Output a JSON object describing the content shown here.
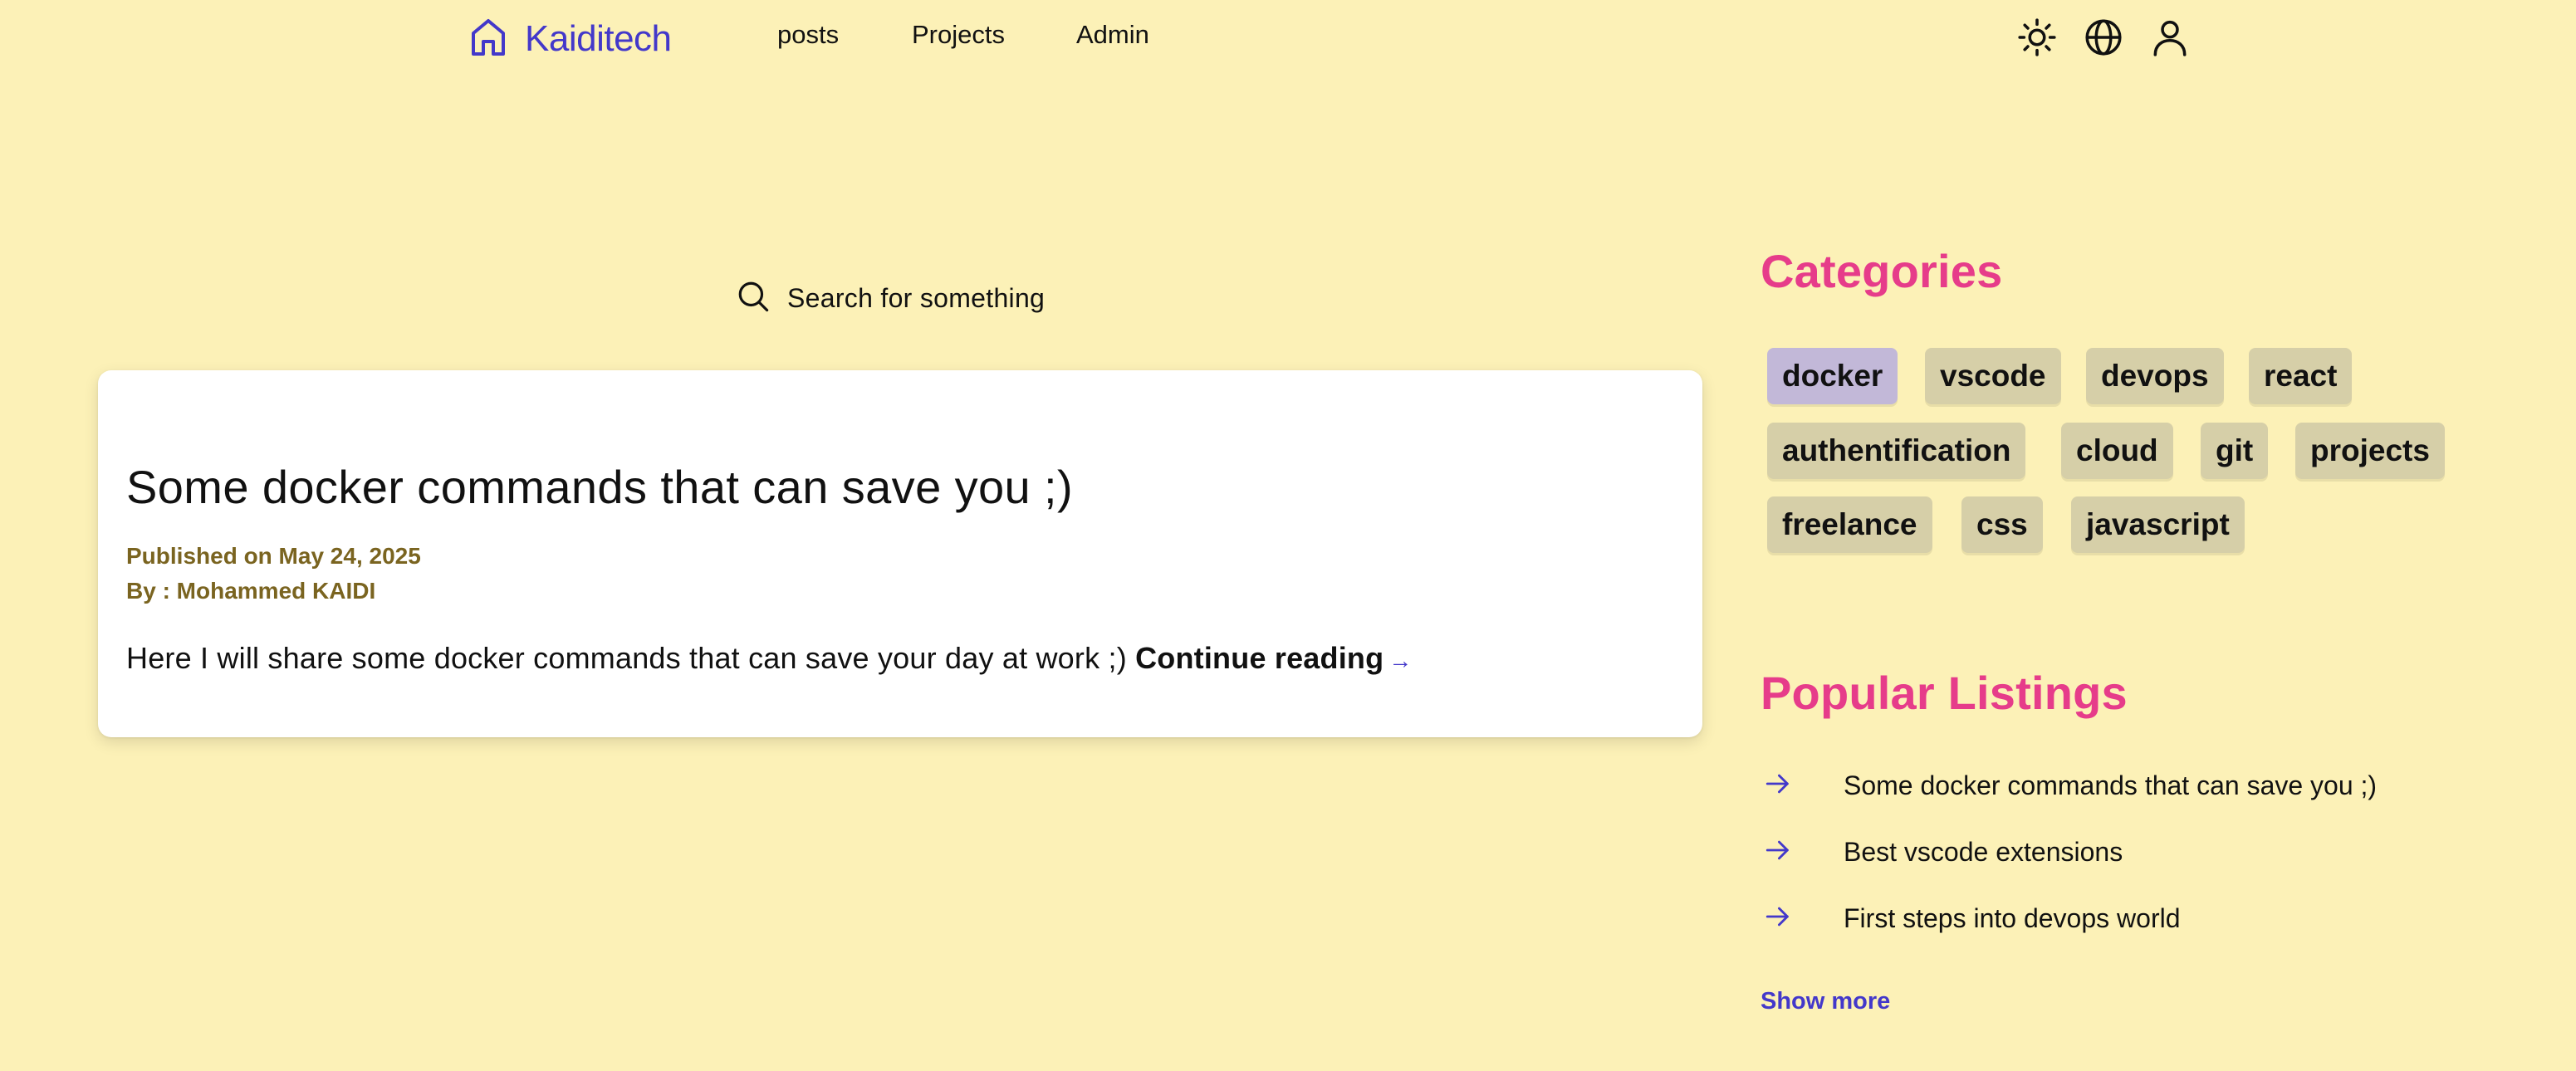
{
  "header": {
    "brand_name": "Kaiditech",
    "nav": {
      "posts": "posts",
      "projects": "Projects",
      "admin": "Admin"
    }
  },
  "search": {
    "placeholder": "Search for something"
  },
  "post": {
    "title": "Some docker commands that can save you ;)",
    "published": "Published on May 24, 2025",
    "author": "By : Mohammed KAIDI",
    "excerpt": "Here I will share some docker commands that can save your day at work ;)",
    "continue_label": "Continue reading",
    "continue_arrow": "→"
  },
  "sidebar": {
    "categories_title": "Categories",
    "categories": [
      {
        "label": "docker",
        "active": true
      },
      {
        "label": "vscode",
        "active": false
      },
      {
        "label": "devops",
        "active": false
      },
      {
        "label": "react",
        "active": false
      },
      {
        "label": "authentification",
        "active": false
      },
      {
        "label": "cloud",
        "active": false
      },
      {
        "label": "git",
        "active": false
      },
      {
        "label": "projects",
        "active": false
      },
      {
        "label": "freelance",
        "active": false
      },
      {
        "label": "css",
        "active": false
      },
      {
        "label": "javascript",
        "active": false
      }
    ],
    "popular_title": "Popular Listings",
    "popular": [
      "Some docker commands that can save you ;)",
      "Best vscode extensions",
      "First steps into devops world"
    ],
    "show_more": "Show more"
  },
  "colors": {
    "background": "#fcf1b7",
    "accent": "#4338ca",
    "heading_pink": "#e63c8a",
    "meta_text": "#7a6420",
    "tag_bg": "#d6cfa8",
    "tag_active_bg": "#c2b8d8"
  },
  "icons": [
    "home-icon",
    "sun-icon",
    "globe-icon",
    "user-icon",
    "search-icon",
    "arrow-right-icon"
  ]
}
